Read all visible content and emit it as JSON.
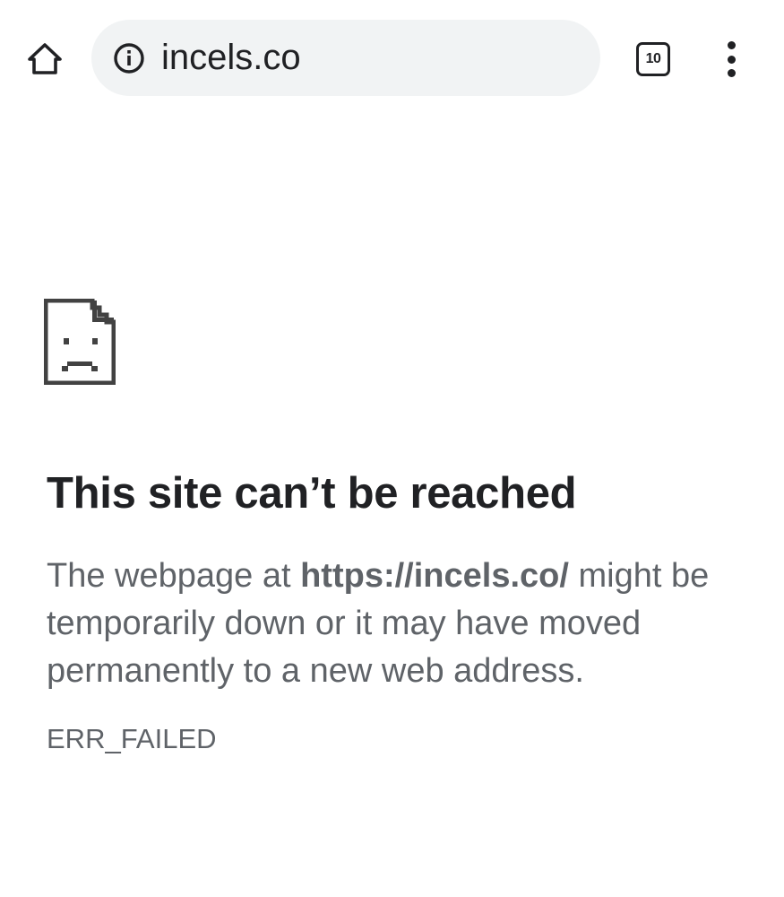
{
  "toolbar": {
    "home_icon": "home-icon",
    "info_icon": "info-icon",
    "url": "incels.co",
    "tab_count": "10",
    "menu_icon": "more-vert-icon"
  },
  "error_page": {
    "icon": "sad-page-icon",
    "headline": "This site can’t be reached",
    "desc_prefix": "The webpage at ",
    "desc_url": "https://incels.co/",
    "desc_suffix": " might be temporarily down or it may have moved permanently to a new web address.",
    "error_code": "ERR_FAILED"
  },
  "colors": {
    "omnibox_bg": "#f1f3f4",
    "text_primary": "#202124",
    "text_secondary": "#5f6368",
    "icon_gray": "#424242"
  }
}
